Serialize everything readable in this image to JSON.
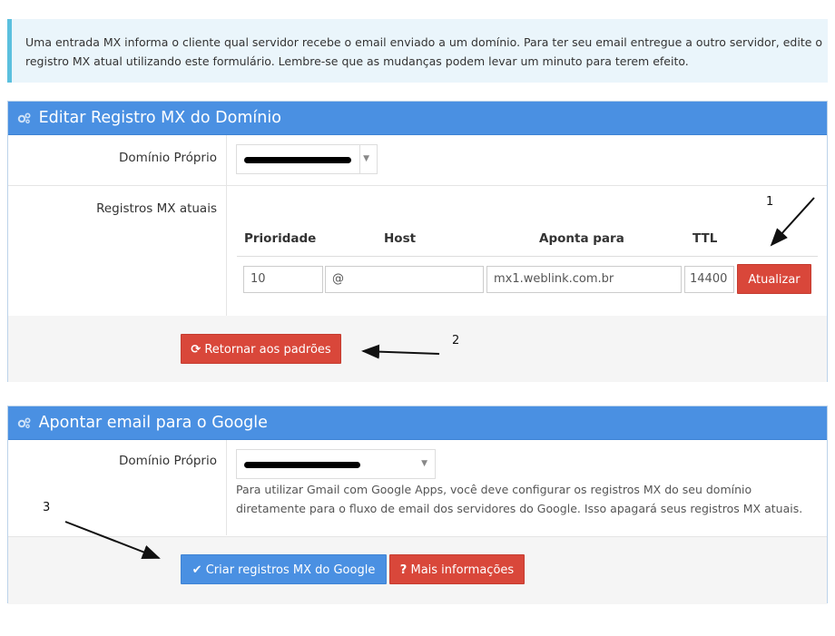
{
  "info_text": "Uma entrada MX informa o cliente qual servidor recebe o email enviado a um domínio. Para ter seu email entregue a outro servidor, edite o registro MX atual utilizando este formulário. Lembre-se que as mudanças podem levar um minuto para terem efeito.",
  "mx_panel": {
    "title": "Editar Registro MX do Domínio",
    "domain_label": "Domínio Próprio",
    "current_label": "Registros MX atuais",
    "table_headers": {
      "priority": "Prioridade",
      "host": "Host",
      "points_to": "Aponta para",
      "ttl": "TTL"
    },
    "record": {
      "priority": "10",
      "host": "@",
      "points_to": "mx1.weblink.com.br",
      "ttl": "14400"
    },
    "update_button": "Atualizar",
    "reset_button": "Retornar aos padrões"
  },
  "google_panel": {
    "title": "Apontar email para o Google",
    "domain_label": "Domínio Próprio",
    "help_text": "Para utilizar Gmail com Google Apps, você deve configurar os registros MX do seu domínio diretamente para o fluxo de email dos servidores do Google. Isso apagará seus registros MX atuais.",
    "create_button": "Criar registros MX do Google",
    "more_info_button": "Mais informações"
  },
  "annotations": [
    "1",
    "2",
    "3"
  ],
  "colors": {
    "primary": "#4a90e2",
    "danger": "#d9473a",
    "info_border": "#5bc0de",
    "info_bg": "#eaf5fb"
  },
  "icons": [
    "cogs-icon",
    "refresh-icon",
    "check-icon",
    "question-icon",
    "caret-down-icon"
  ]
}
